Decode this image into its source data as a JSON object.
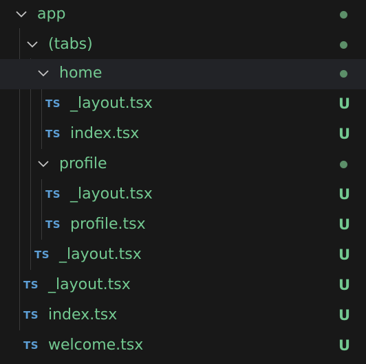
{
  "colors": {
    "added": "#73c991",
    "ts_icon": "#5d9fd6",
    "modified_dot": "#73c991"
  },
  "tree": {
    "app": {
      "label": "app",
      "icon": "chevron-down-icon"
    },
    "tabs": {
      "label": "(tabs)",
      "icon": "chevron-down-icon"
    },
    "home": {
      "label": "home",
      "icon": "chevron-down-icon"
    },
    "home_layout": {
      "icon_text": "TS",
      "label": "_layout.tsx",
      "status": "U"
    },
    "home_index": {
      "icon_text": "TS",
      "label": "index.tsx",
      "status": "U"
    },
    "profile": {
      "label": "profile",
      "icon": "chevron-down-icon"
    },
    "profile_layout": {
      "icon_text": "TS",
      "label": "_layout.tsx",
      "status": "U"
    },
    "profile_profile": {
      "icon_text": "TS",
      "label": "profile.tsx",
      "status": "U"
    },
    "tabs_layout": {
      "icon_text": "TS",
      "label": "_layout.tsx",
      "status": "U"
    },
    "app_layout": {
      "icon_text": "TS",
      "label": "_layout.tsx",
      "status": "U"
    },
    "app_index": {
      "icon_text": "TS",
      "label": "index.tsx",
      "status": "U"
    },
    "app_welcome": {
      "icon_text": "TS",
      "label": "welcome.tsx",
      "status": "U"
    }
  }
}
